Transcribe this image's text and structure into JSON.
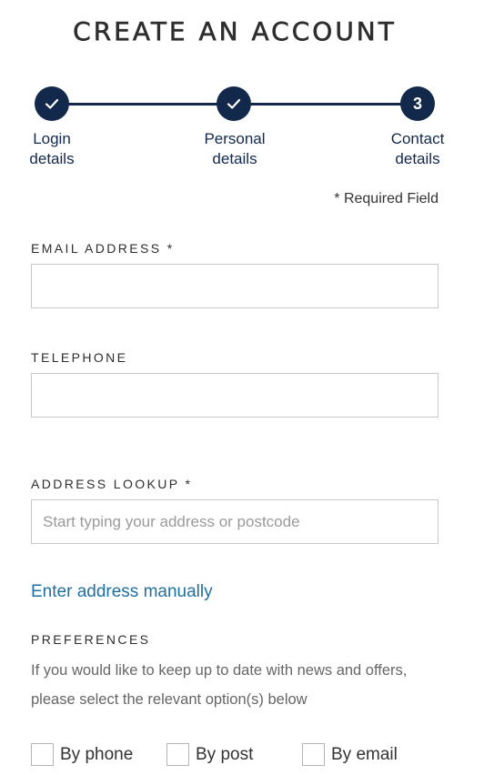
{
  "page": {
    "title": "CREATE AN ACCOUNT"
  },
  "stepper": {
    "steps": [
      {
        "state": "complete",
        "icon": "checkmark-icon",
        "line1": "Login",
        "line2": "details"
      },
      {
        "state": "complete",
        "icon": "checkmark-icon",
        "line1": "Personal",
        "line2": "details"
      },
      {
        "state": "current",
        "number": "3",
        "line1": "Contact",
        "line2": "details"
      }
    ],
    "accent_color": "#13294b"
  },
  "form": {
    "required_note": "* Required Field",
    "email": {
      "label": "EMAIL ADDRESS *",
      "value": "",
      "placeholder": ""
    },
    "telephone": {
      "label": "TELEPHONE",
      "value": "",
      "placeholder": ""
    },
    "address": {
      "label": "ADDRESS LOOKUP *",
      "value": "",
      "placeholder": "Start typing your address or postcode"
    },
    "manual_link": "Enter address manually",
    "link_color": "#1f6fa0"
  },
  "preferences": {
    "heading": "PREFERENCES",
    "description": "If you would like to keep up to date with news and offers, please select the relevant option(s) below",
    "options": [
      {
        "label": "By phone",
        "checked": false
      },
      {
        "label": "By post",
        "checked": false
      },
      {
        "label": "By email",
        "checked": false
      }
    ]
  }
}
